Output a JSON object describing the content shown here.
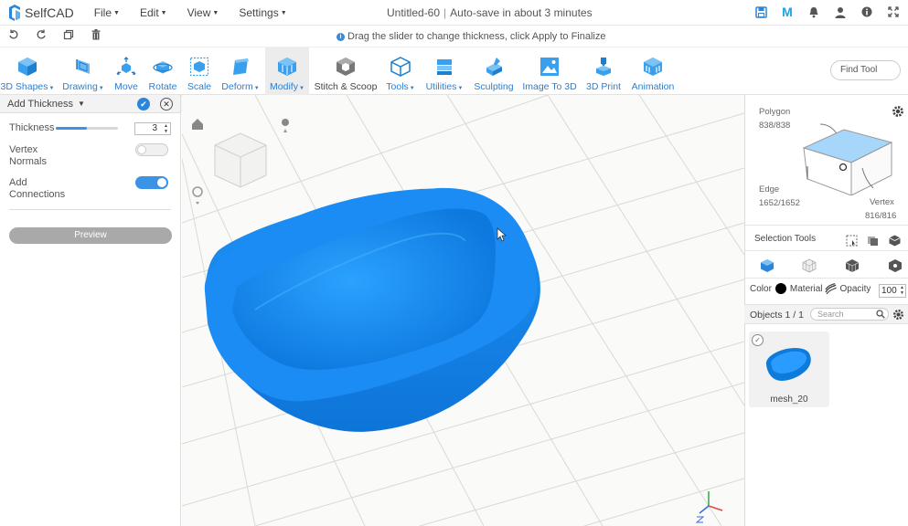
{
  "app": {
    "name": "SelfCAD",
    "doc_title": "Untitled-60",
    "autosave": "Auto-save in about 3 minutes"
  },
  "menus": [
    {
      "label": "File"
    },
    {
      "label": "Edit"
    },
    {
      "label": "View"
    },
    {
      "label": "Settings"
    }
  ],
  "top_icons": [
    "save-icon",
    "m-icon",
    "bell-icon",
    "user-icon",
    "info-icon",
    "fullscreen-icon"
  ],
  "hint": {
    "text": "Drag the slider to change thickness, click Apply to Finalize"
  },
  "toolbar": {
    "tools": [
      {
        "label": "3D Shapes",
        "dropdown": true
      },
      {
        "label": "Drawing",
        "dropdown": true
      },
      {
        "label": "Move"
      },
      {
        "label": "Rotate"
      },
      {
        "label": "Scale"
      },
      {
        "label": "Deform",
        "dropdown": true
      },
      {
        "label": "Modify",
        "dropdown": true,
        "active": true
      },
      {
        "label": "Stitch & Scoop"
      },
      {
        "label": "Tools",
        "dropdown": true
      },
      {
        "label": "Utilities",
        "dropdown": true
      },
      {
        "label": "Sculpting"
      },
      {
        "label": "Image To 3D"
      },
      {
        "label": "3D Print"
      },
      {
        "label": "Animation"
      }
    ],
    "find_tool": "Find Tool"
  },
  "left_panel": {
    "title": "Add Thickness",
    "thickness_label": "Thickness",
    "thickness_value": "3",
    "thickness_fraction": 0.5,
    "vertex_normals_label_1": "Vertex",
    "vertex_normals_label_2": "Normals",
    "vertex_normals_on": false,
    "add_connections_label_1": "Add",
    "add_connections_label_2": "Connections",
    "add_connections_on": true,
    "preview_label": "Preview"
  },
  "right_panel": {
    "polygon_label": "Polygon",
    "polygon_count": "838/838",
    "edge_label": "Edge",
    "edge_count": "1652/1652",
    "vertex_label": "Vertex",
    "vertex_count": "816/816",
    "selection_tools": "Selection Tools",
    "color_label": "Color",
    "material_label": "Material",
    "opacity_label": "Opacity",
    "opacity_value": "100",
    "objects_label": "Objects 1 / 1",
    "search_placeholder": "Search",
    "object_name": "mesh_20"
  },
  "colors": {
    "accent": "#2b7fd1",
    "mesh": "#1e8ef2",
    "toggle_on": "#3a93e5"
  }
}
